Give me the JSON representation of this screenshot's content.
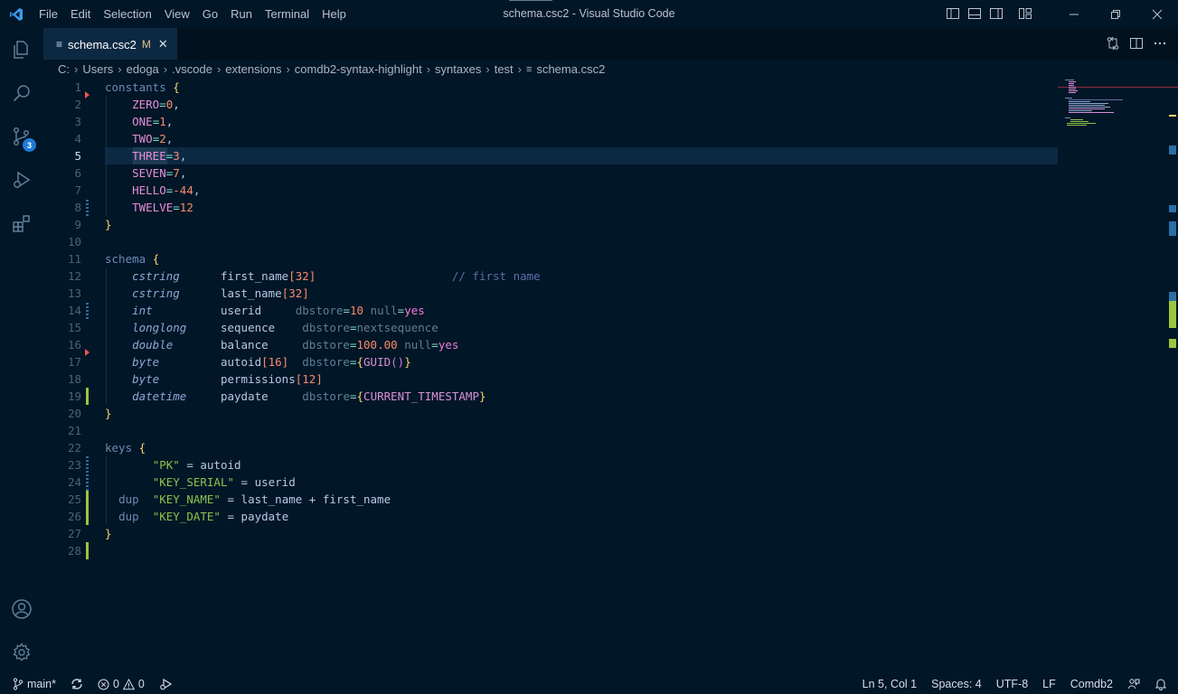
{
  "window": {
    "title": "schema.csc2 - Visual Studio Code"
  },
  "menu": [
    "File",
    "Edit",
    "Selection",
    "View",
    "Go",
    "Run",
    "Terminal",
    "Help"
  ],
  "activity_bar": {
    "items": [
      "files-icon",
      "search-icon",
      "source-control-icon",
      "run-debug-icon",
      "extensions-icon"
    ],
    "source_control_badge": "3",
    "bottom": [
      "account-icon",
      "settings-gear-icon"
    ]
  },
  "tab": {
    "label": "schema.csc2",
    "modified": "M",
    "close": "✕"
  },
  "breadcrumbs": [
    "C:",
    "Users",
    "edoga",
    ".vscode",
    "extensions",
    "comdb2-syntax-highlight",
    "syntaxes",
    "test",
    "schema.csc2"
  ],
  "editor": {
    "line_numbers": [
      "1",
      "2",
      "3",
      "4",
      "5",
      "6",
      "7",
      "8",
      "9",
      "10",
      "11",
      "12",
      "13",
      "14",
      "15",
      "16",
      "17",
      "18",
      "19",
      "20",
      "21",
      "22",
      "23",
      "24",
      "25",
      "26",
      "27",
      "28"
    ],
    "active_line": "5",
    "code": {
      "l1": [
        "constants",
        " ",
        "{"
      ],
      "l2": [
        "ZERO",
        "=",
        "0",
        ","
      ],
      "l3": [
        "ONE",
        "=",
        "1",
        ","
      ],
      "l4": [
        "TWO",
        "=",
        "2",
        ","
      ],
      "l5": [
        "THREE",
        "=",
        "3",
        ","
      ],
      "l6": [
        "SEVEN",
        "=",
        "7",
        ","
      ],
      "l7": [
        "HELLO",
        "=",
        "-44",
        ","
      ],
      "l8": [
        "TWELVE",
        "=",
        "12"
      ],
      "l9": [
        "}"
      ],
      "l11": [
        "schema",
        "{"
      ],
      "l12": [
        "cstring",
        "first_name",
        "[32]",
        "// first name"
      ],
      "l13": [
        "cstring",
        "last_name",
        "[32]"
      ],
      "l14": [
        "int",
        "userid",
        "dbstore",
        "=",
        "10",
        "null",
        "=",
        "yes"
      ],
      "l15": [
        "longlong",
        "sequence",
        "dbstore",
        "=",
        "nextsequence"
      ],
      "l16": [
        "double",
        "balance",
        "dbstore",
        "=",
        "100.00",
        "null",
        "=",
        "yes"
      ],
      "l17": [
        "byte",
        "autoid",
        "[16]",
        "dbstore",
        "=",
        "{",
        "GUID",
        "()",
        "}"
      ],
      "l18": [
        "byte",
        "permissions",
        "[12]"
      ],
      "l19": [
        "datetime",
        "paydate",
        "dbstore",
        "=",
        "{",
        "CURRENT_TIMESTAMP",
        "}"
      ],
      "l20": [
        "}"
      ],
      "l22": [
        "keys",
        "{"
      ],
      "l23": [
        "\"PK\"",
        " = ",
        "autoid"
      ],
      "l24": [
        "\"KEY_SERIAL\"",
        " = ",
        "userid"
      ],
      "l25": [
        "dup",
        "\"KEY_NAME\"",
        " = ",
        "last_name + first_name"
      ],
      "l26": [
        "dup",
        "\"KEY_DATE\"",
        " = ",
        "paydate"
      ],
      "l27": [
        "}"
      ]
    }
  },
  "status_bar": {
    "branch": "main*",
    "errors": "0",
    "warnings": "0",
    "position": "Ln 5, Col 1",
    "spaces": "Spaces: 4",
    "encoding": "UTF-8",
    "eol": "LF",
    "language": "Comdb2"
  },
  "colors": {
    "background": "#011627",
    "tab_active": "#0b2942",
    "line_highlight": "#0b2942",
    "badge": "#1e7bd8",
    "git_added": "#9bc53d",
    "git_modified": "#2b6fa6",
    "git_deleted": "#ef5350"
  }
}
